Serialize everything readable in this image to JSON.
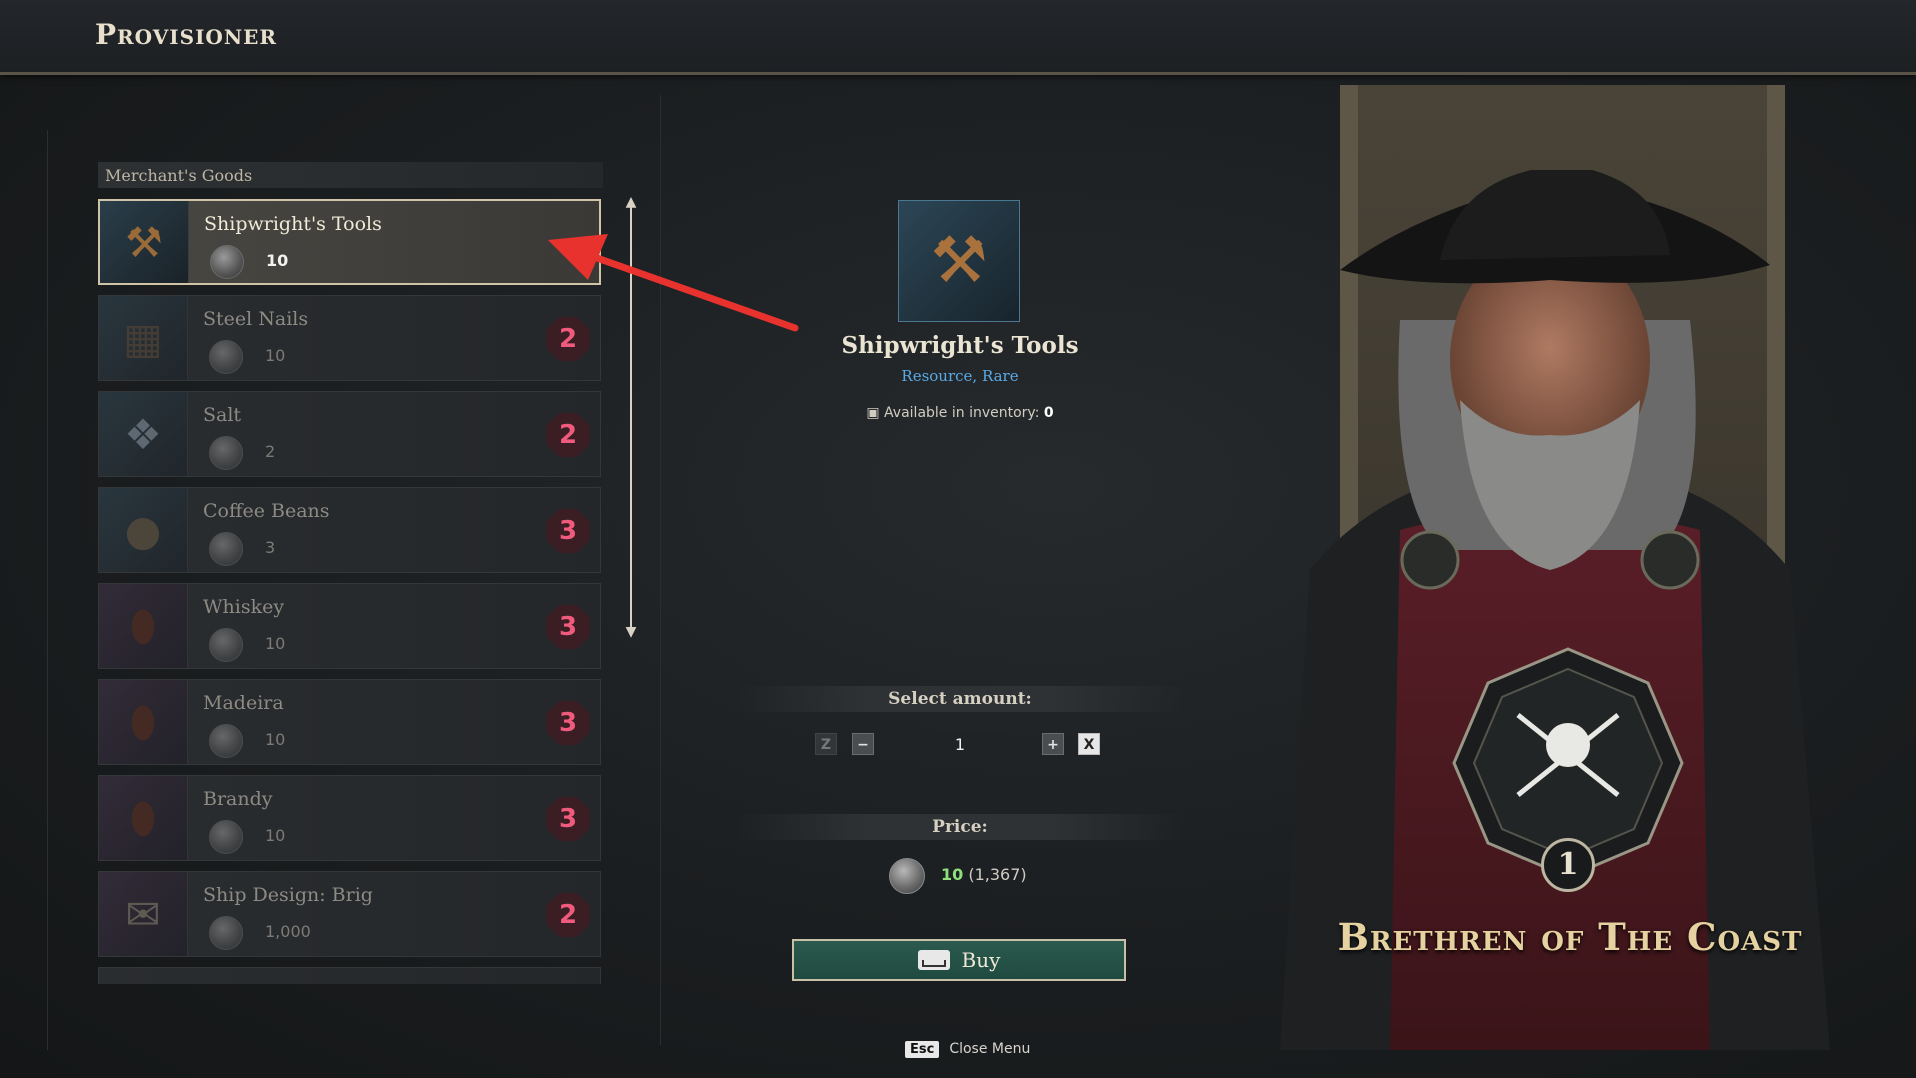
{
  "header": {
    "title": "Provisioner"
  },
  "goods": {
    "section_title": "Merchant's Goods",
    "items": [
      {
        "name": "Shipwright's Tools",
        "price": "10",
        "badge": "",
        "selected": true,
        "icon": "tools-icon"
      },
      {
        "name": "Steel Nails",
        "price": "10",
        "badge": "2",
        "selected": false,
        "icon": "nails-icon"
      },
      {
        "name": "Salt",
        "price": "2",
        "badge": "2",
        "selected": false,
        "icon": "salt-icon"
      },
      {
        "name": "Coffee Beans",
        "price": "3",
        "badge": "3",
        "selected": false,
        "icon": "sack-icon"
      },
      {
        "name": "Whiskey",
        "price": "10",
        "badge": "3",
        "selected": false,
        "icon": "bottle-icon"
      },
      {
        "name": "Madeira",
        "price": "10",
        "badge": "3",
        "selected": false,
        "icon": "bottle-icon"
      },
      {
        "name": "Brandy",
        "price": "10",
        "badge": "3",
        "selected": false,
        "icon": "bottle-icon"
      },
      {
        "name": "Ship Design: Brig",
        "price": "1,000",
        "badge": "2",
        "selected": false,
        "icon": "scroll-icon"
      }
    ]
  },
  "detail": {
    "name": "Shipwright's Tools",
    "subtitle": "Resource, Rare",
    "inventory_label": "Available in inventory:",
    "inventory_value": "0",
    "amount_label": "Select amount:",
    "amount_value": "1",
    "key_decrease": "Z",
    "key_increase": "X",
    "price_label": "Price:",
    "price_value": "10",
    "price_balance": "(1,367)",
    "buy_label": "Buy"
  },
  "footer": {
    "esc_key": "Esc",
    "close_label": "Close Menu"
  },
  "merchant": {
    "faction": "Brethren of The Coast",
    "level": "1"
  },
  "colors": {
    "accent_green": "#8fe07a",
    "badge_pink": "#f05a7c",
    "subtitle_blue": "#5aa9e6",
    "arrow_red": "#e8322e"
  }
}
